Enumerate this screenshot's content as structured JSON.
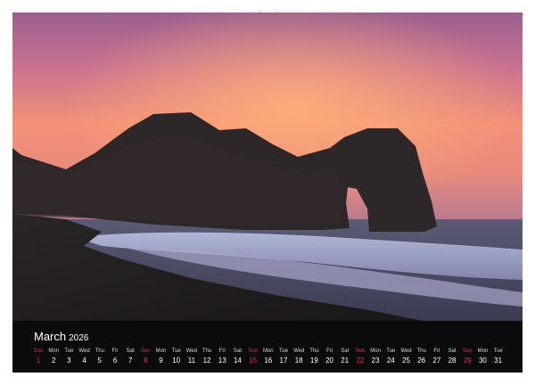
{
  "calendar": {
    "month": "March",
    "year": "2026",
    "days": [
      {
        "wd": "Sun",
        "n": "1",
        "sun": true
      },
      {
        "wd": "Mon",
        "n": "2"
      },
      {
        "wd": "Tue",
        "n": "3"
      },
      {
        "wd": "Wed",
        "n": "4"
      },
      {
        "wd": "Thu",
        "n": "5"
      },
      {
        "wd": "Fri",
        "n": "6"
      },
      {
        "wd": "Sat",
        "n": "7"
      },
      {
        "wd": "Sun",
        "n": "8",
        "sun": true
      },
      {
        "wd": "Mon",
        "n": "9"
      },
      {
        "wd": "Tue",
        "n": "10"
      },
      {
        "wd": "Wed",
        "n": "11"
      },
      {
        "wd": "Thu",
        "n": "12"
      },
      {
        "wd": "Fri",
        "n": "13"
      },
      {
        "wd": "Sat",
        "n": "14"
      },
      {
        "wd": "Sun",
        "n": "15",
        "sun": true
      },
      {
        "wd": "Mon",
        "n": "16"
      },
      {
        "wd": "Tue",
        "n": "17"
      },
      {
        "wd": "Wed",
        "n": "18"
      },
      {
        "wd": "Thu",
        "n": "19"
      },
      {
        "wd": "Fri",
        "n": "20"
      },
      {
        "wd": "Sat",
        "n": "21"
      },
      {
        "wd": "Sun",
        "n": "22",
        "sun": true
      },
      {
        "wd": "Mon",
        "n": "23"
      },
      {
        "wd": "Tue",
        "n": "24"
      },
      {
        "wd": "Wed",
        "n": "25"
      },
      {
        "wd": "Thu",
        "n": "26"
      },
      {
        "wd": "Fri",
        "n": "27"
      },
      {
        "wd": "Sat",
        "n": "28"
      },
      {
        "wd": "Sun",
        "n": "29",
        "sun": true
      },
      {
        "wd": "Mon",
        "n": "30"
      },
      {
        "wd": "Tue",
        "n": "31"
      }
    ]
  },
  "colors": {
    "sunday": "#e0343d",
    "calendar_bar": "#0b0b0b",
    "sky_top": "#8e5a8e",
    "sky_glow": "#f59a74"
  }
}
